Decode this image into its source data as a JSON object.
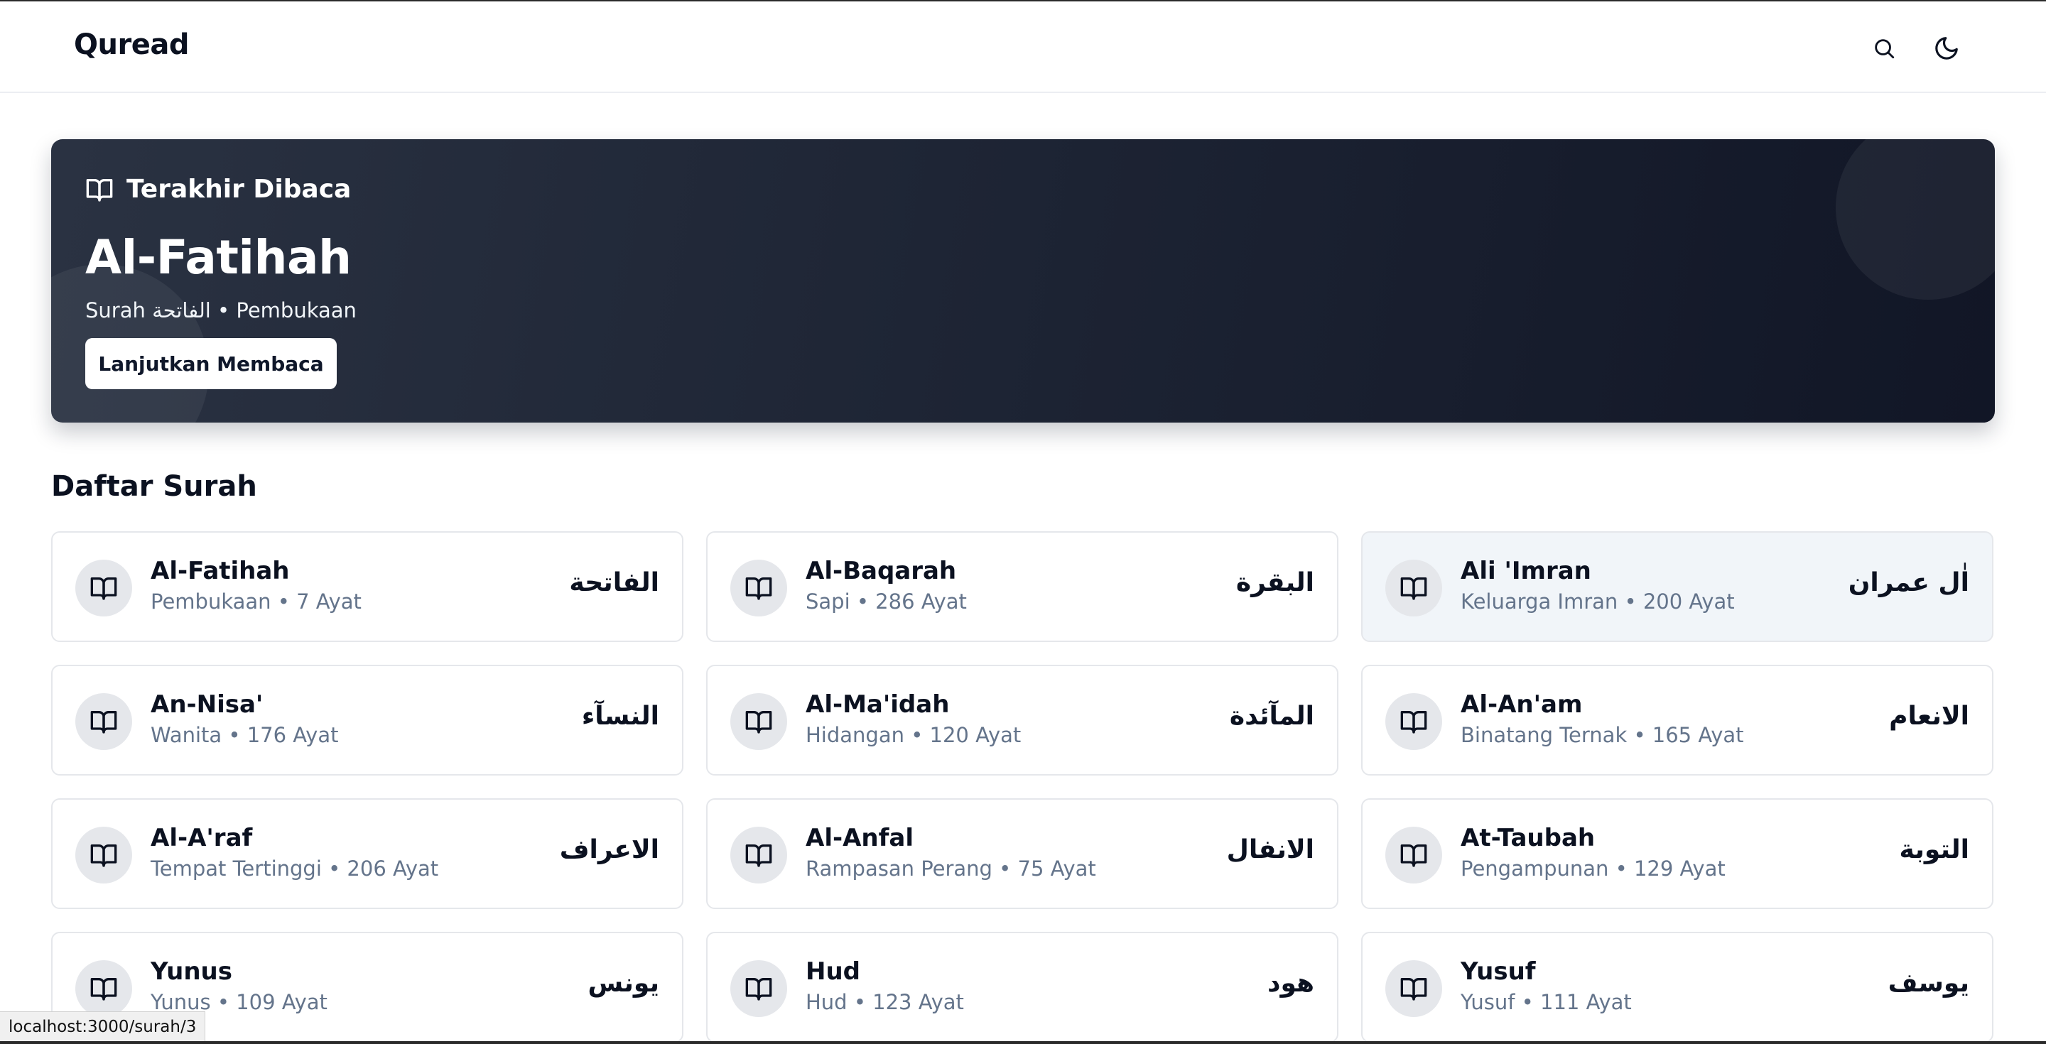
{
  "app": {
    "brand": "Quread"
  },
  "header": {
    "search_icon": "search-icon",
    "theme_icon": "moon-icon"
  },
  "hero": {
    "label": "Terakhir Dibaca",
    "title": "Al-Fatihah",
    "subtitle": "Surah الفاتحة • Pembukaan",
    "button": "Lanjutkan Membaca",
    "icon": "book-open-icon"
  },
  "section": {
    "title": "Daftar Surah"
  },
  "surahs": [
    {
      "name": "Al-Fatihah",
      "meta": "Pembukaan • 7 Ayat",
      "arabic": "الفاتحة"
    },
    {
      "name": "Al-Baqarah",
      "meta": "Sapi • 286 Ayat",
      "arabic": "البقرة"
    },
    {
      "name": "Ali 'Imran",
      "meta": "Keluarga Imran • 200 Ayat",
      "arabic": "اٰل عمران"
    },
    {
      "name": "An-Nisa'",
      "meta": "Wanita • 176 Ayat",
      "arabic": "النسآء"
    },
    {
      "name": "Al-Ma'idah",
      "meta": "Hidangan • 120 Ayat",
      "arabic": "المآئدة"
    },
    {
      "name": "Al-An'am",
      "meta": "Binatang Ternak • 165 Ayat",
      "arabic": "الانعام"
    },
    {
      "name": "Al-A'raf",
      "meta": "Tempat Tertinggi • 206 Ayat",
      "arabic": "الاعراف"
    },
    {
      "name": "Al-Anfal",
      "meta": "Rampasan Perang • 75 Ayat",
      "arabic": "الانفال"
    },
    {
      "name": "At-Taubah",
      "meta": "Pengampunan • 129 Ayat",
      "arabic": "التوبة"
    },
    {
      "name": "Yunus",
      "meta": "Yunus • 109 Ayat",
      "arabic": "يونس"
    },
    {
      "name": "Hud",
      "meta": "Hud • 123 Ayat",
      "arabic": "هود"
    },
    {
      "name": "Yusuf",
      "meta": "Yusuf • 111 Ayat",
      "arabic": "يوسف"
    }
  ],
  "status_bar": {
    "url": "localhost:3000/surah/3"
  },
  "colors": {
    "hero_bg": "#1e2535",
    "card_border": "#e5e7eb",
    "card_hover": "#f1f5f9",
    "muted_text": "#64748b"
  }
}
